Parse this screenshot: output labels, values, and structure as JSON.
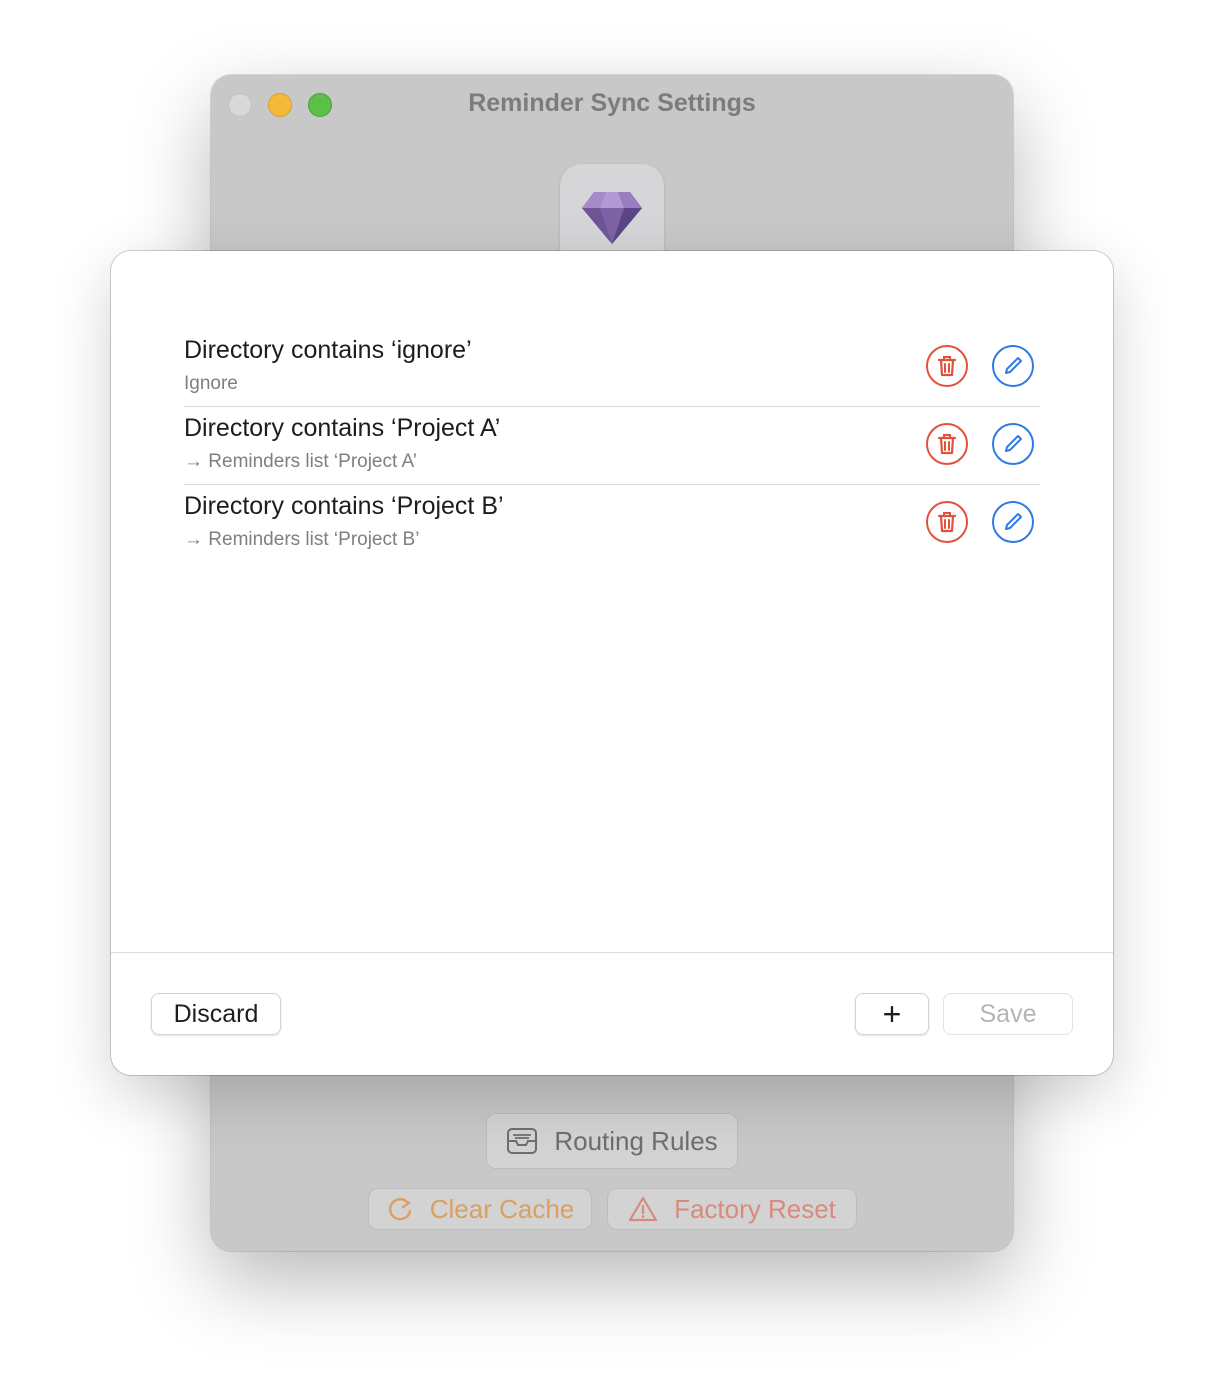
{
  "window": {
    "title": "Reminder Sync Settings"
  },
  "background_buttons": {
    "routing_rules": "Routing Rules",
    "clear_cache": "Clear Cache",
    "factory_reset": "Factory Reset"
  },
  "rules": [
    {
      "title": "Directory contains ‘ignore’",
      "subtitle": "Ignore"
    },
    {
      "title": "Directory contains ‘Project A’",
      "subtitle": "→ Reminders list ‘Project A’"
    },
    {
      "title": "Directory contains ‘Project B’",
      "subtitle": "→ Reminders list ‘Project B’"
    }
  ],
  "footer": {
    "discard_label": "Discard",
    "add_label": "+",
    "save_label": "Save"
  },
  "colors": {
    "delete": "#e4513a",
    "edit": "#2f7ae5",
    "clear_cache": "#d9a061",
    "factory_reset": "#d98a7e"
  },
  "icons": [
    "diamond-icon",
    "trash-icon",
    "pencil-icon",
    "tray-icon",
    "refresh-icon",
    "warning-icon"
  ]
}
